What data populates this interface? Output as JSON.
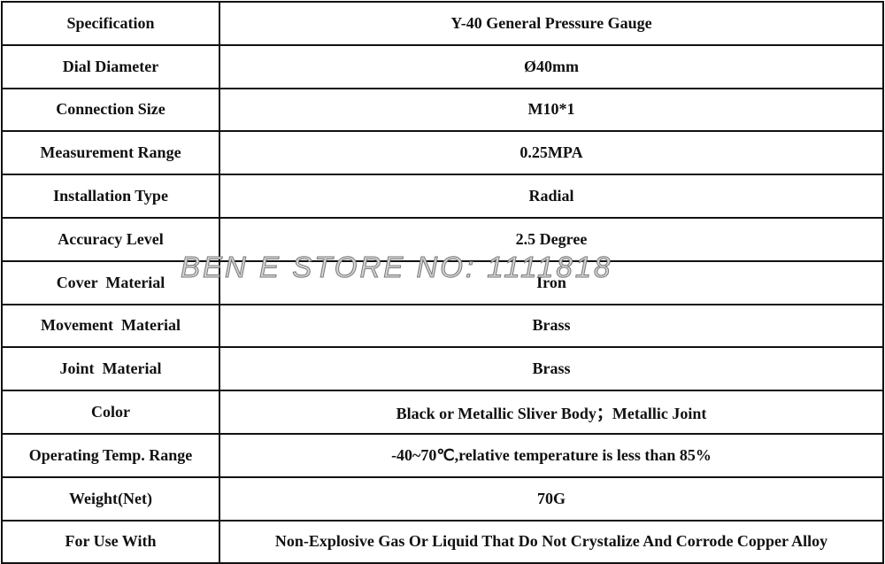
{
  "rows": [
    {
      "label": "Specification",
      "value": "Y-40 General Pressure Gauge"
    },
    {
      "label": "Dial Diameter",
      "value": "Ø40mm"
    },
    {
      "label": "Connection Size",
      "value": "M10*1"
    },
    {
      "label": "Measurement Range",
      "value": "0.25MPA"
    },
    {
      "label": "Installation Type",
      "value": "Radial"
    },
    {
      "label": "Accuracy Level",
      "value": "2.5 Degree"
    },
    {
      "label": "Cover  Material",
      "value": "Iron"
    },
    {
      "label": "Movement  Material",
      "value": "Brass"
    },
    {
      "label": "Joint  Material",
      "value": "Brass"
    },
    {
      "label": "Color",
      "value": "Black or Metallic Sliver Body；Metallic Joint"
    },
    {
      "label": "Operating Temp. Range",
      "value": "-40~70℃,relative temperature is less than 85%"
    },
    {
      "label": "Weight(Net)",
      "value": "70G"
    },
    {
      "label": "For Use With",
      "value": "Non-Explosive Gas Or Liquid That Do Not Crystalize And Corrode Copper Alloy"
    }
  ],
  "watermark": "BEN E STORE NO: 1111818"
}
